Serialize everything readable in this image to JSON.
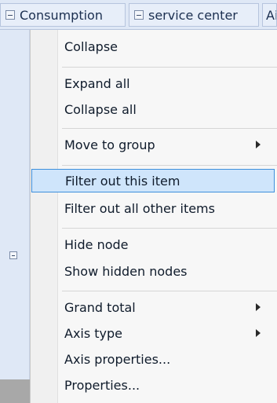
{
  "header": {
    "col1": "Consumption",
    "col2": "service center",
    "col3": "Ai"
  },
  "menu": {
    "items": [
      {
        "label": "Collapse",
        "submenu": false
      },
      {
        "label": "Expand all",
        "submenu": false
      },
      {
        "label": "Collapse all",
        "submenu": false
      },
      {
        "label": "Move to group",
        "submenu": true
      },
      {
        "label": "Filter out this item",
        "submenu": false,
        "highlighted": true
      },
      {
        "label": "Filter out all other items",
        "submenu": false
      },
      {
        "label": "Hide node",
        "submenu": false
      },
      {
        "label": "Show hidden nodes",
        "submenu": false
      },
      {
        "label": "Grand total",
        "submenu": true
      },
      {
        "label": "Axis type",
        "submenu": true
      },
      {
        "label": "Axis properties...",
        "submenu": false
      },
      {
        "label": "Properties...",
        "submenu": false
      }
    ]
  },
  "colors": {
    "highlight_bg": "#cfe5fb",
    "highlight_border": "#3d8fdc",
    "header_bg": "#dfe8f6",
    "menu_bg": "#f7f7f7"
  }
}
